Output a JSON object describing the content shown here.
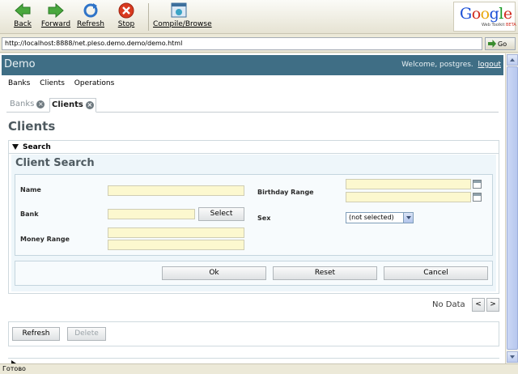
{
  "browser": {
    "toolbar": {
      "back": "Back",
      "forward": "Forward",
      "refresh": "Refresh",
      "stop": "Stop",
      "compile": "Compile/Browse"
    },
    "logo": {
      "brand": "Google",
      "sub": "Web Toolkit",
      "beta": "BETA"
    },
    "url": "http://localhost:8888/net.pleso.demo.demo/demo.html",
    "go": "Go",
    "status": "Готово",
    "colors": {
      "back_arrow": "#3c9a33",
      "refresh": "#2f74c8",
      "stop": "#d93a1f",
      "header": "#3f6e85"
    }
  },
  "app": {
    "title": "Demo",
    "welcome": "Welcome, postgres.",
    "logout": "logout",
    "menu": [
      "Banks",
      "Clients",
      "Operations"
    ],
    "tabs": [
      {
        "label": "Banks",
        "active": false
      },
      {
        "label": "Clients",
        "active": true
      }
    ],
    "page_title": "Clients",
    "search_panel": {
      "header": "Search",
      "title": "Client Search",
      "fields": {
        "name": "Name",
        "bank": "Bank",
        "money_range": "Money Range",
        "birthday_range": "Birthday Range",
        "sex": "Sex"
      },
      "bank_select_button": "Select",
      "sex_value": "(not selected)",
      "buttons": {
        "ok": "Ok",
        "reset": "Reset",
        "cancel": "Cancel"
      }
    },
    "grid": {
      "no_data": "No Data",
      "prev": "<",
      "next": ">"
    },
    "bottom_buttons": {
      "refresh": "Refresh",
      "delete": "Delete"
    }
  }
}
